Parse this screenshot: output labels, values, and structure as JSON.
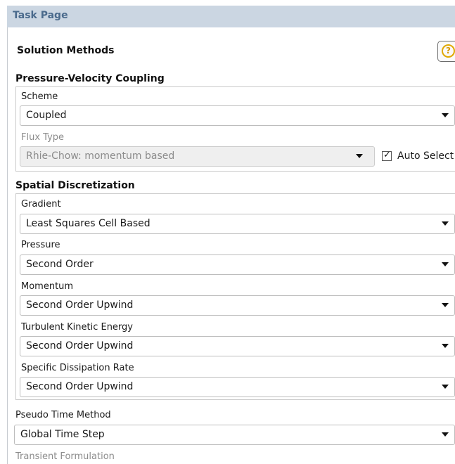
{
  "task_page": {
    "title": "Task Page"
  },
  "section": {
    "title": "Solution Methods",
    "help_icon": "?"
  },
  "pressure_velocity": {
    "title": "Pressure-Velocity Coupling",
    "scheme_label": "Scheme",
    "scheme_value": "Coupled",
    "flux_type_label": "Flux Type",
    "flux_type_value": "Rhie-Chow: momentum based",
    "auto_select_label": "Auto Select",
    "auto_select_checked": true
  },
  "spatial": {
    "title": "Spatial Discretization",
    "fields": [
      {
        "label": "Gradient",
        "value": "Least Squares Cell Based"
      },
      {
        "label": "Pressure",
        "value": "Second Order"
      },
      {
        "label": "Momentum",
        "value": "Second Order Upwind"
      },
      {
        "label": "Turbulent Kinetic Energy",
        "value": "Second Order Upwind"
      },
      {
        "label": "Specific Dissipation Rate",
        "value": "Second Order Upwind"
      }
    ]
  },
  "pseudo_time": {
    "label": "Pseudo Time Method",
    "value": "Global Time Step"
  },
  "transient": {
    "label": "Transient Formulation"
  },
  "colors": {
    "header_bg": "#cbd6e2",
    "header_text": "#4a6a8c",
    "help_accent": "#e0a800"
  }
}
